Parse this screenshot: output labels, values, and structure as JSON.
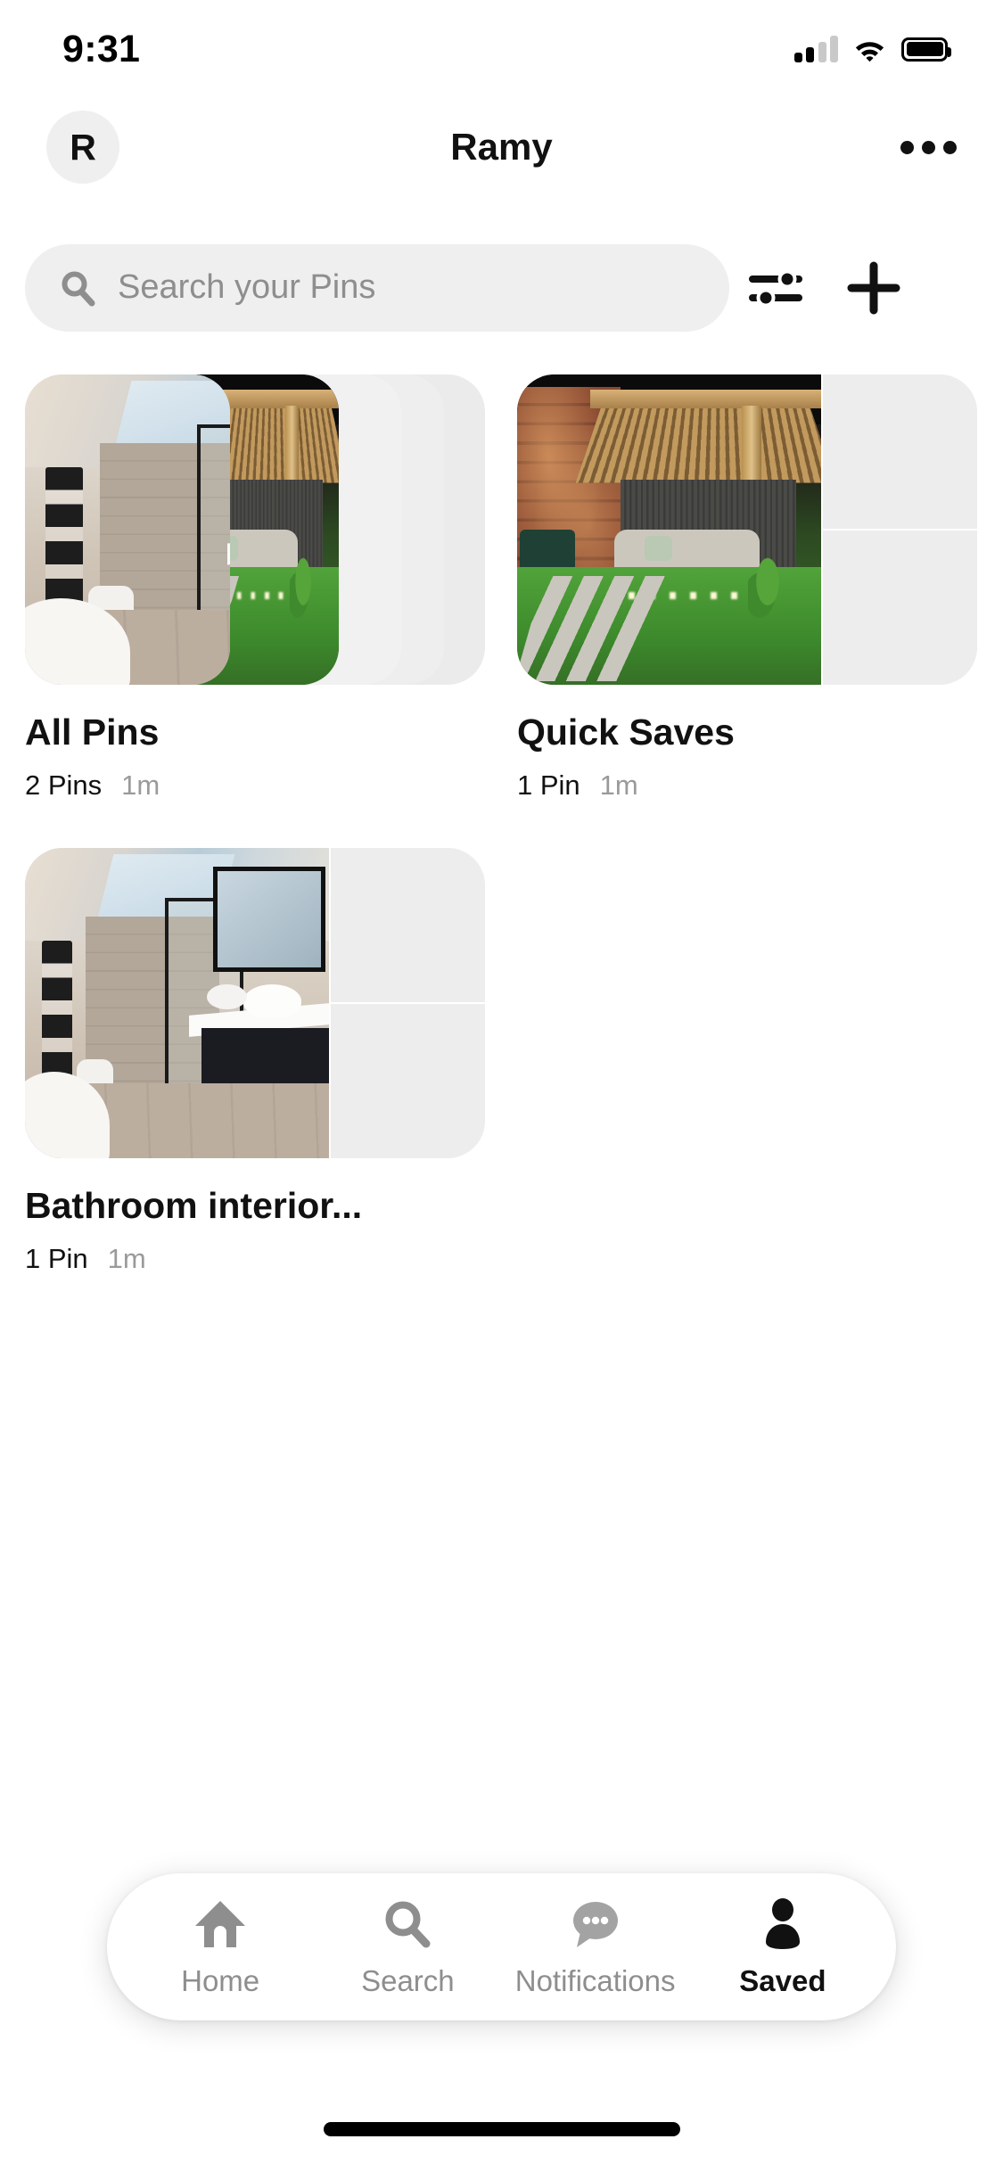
{
  "status_bar": {
    "time": "9:31",
    "signal_icon": "cellular-signal-icon",
    "wifi_icon": "wifi-icon",
    "battery_icon": "battery-full-icon"
  },
  "header": {
    "avatar_initial": "R",
    "title": "Ramy",
    "more_icon": "more-options-icon"
  },
  "search": {
    "placeholder": "Search your Pins",
    "search_icon": "search-icon",
    "filter_icon": "filter-sliders-icon",
    "add_icon": "plus-icon"
  },
  "boards": [
    {
      "title": "All Pins",
      "pins": "2 Pins",
      "time": "1m",
      "layout": "stacked"
    },
    {
      "title": "Quick Saves",
      "pins": "1 Pin",
      "time": "1m",
      "layout": "split"
    },
    {
      "title": "Bathroom interior...",
      "pins": "1 Pin",
      "time": "1m",
      "layout": "split"
    }
  ],
  "bottom_nav": {
    "items": [
      {
        "label": "Home",
        "icon": "home-icon",
        "active": false
      },
      {
        "label": "Search",
        "icon": "search-icon",
        "active": false
      },
      {
        "label": "Notifications",
        "icon": "chat-bubble-icon",
        "active": false
      },
      {
        "label": "Saved",
        "icon": "profile-person-icon",
        "active": true
      }
    ]
  },
  "colors": {
    "background": "#ffffff",
    "text_primary": "#111111",
    "text_secondary": "#8e8e8e",
    "field_bg": "#efefef",
    "placeholder_tile": "#ededed"
  }
}
